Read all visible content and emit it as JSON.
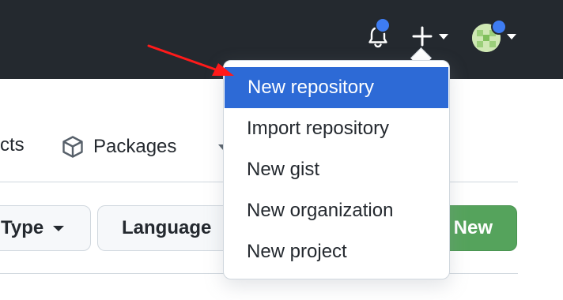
{
  "header": {
    "notification_icon": "bell-icon",
    "create_icon": "plus-icon",
    "avatar_icon": "user-avatar",
    "badge_color": "#3e7cf2",
    "bg_color": "#24292f"
  },
  "tabs": {
    "partial_label": "cts",
    "packages_label": "Packages",
    "packages_icon": "package-icon"
  },
  "filters": {
    "type_label": "Type",
    "language_label": "Language",
    "new_label": "New",
    "new_color": "#55a35c"
  },
  "menu": {
    "items": [
      {
        "label": "New repository",
        "active": true
      },
      {
        "label": "Import repository"
      },
      {
        "label": "New gist"
      },
      {
        "label": "New organization"
      },
      {
        "label": "New project"
      }
    ],
    "active_color": "#2d6ad6"
  },
  "annotation": {
    "arrow_color": "#ff1a1a"
  }
}
